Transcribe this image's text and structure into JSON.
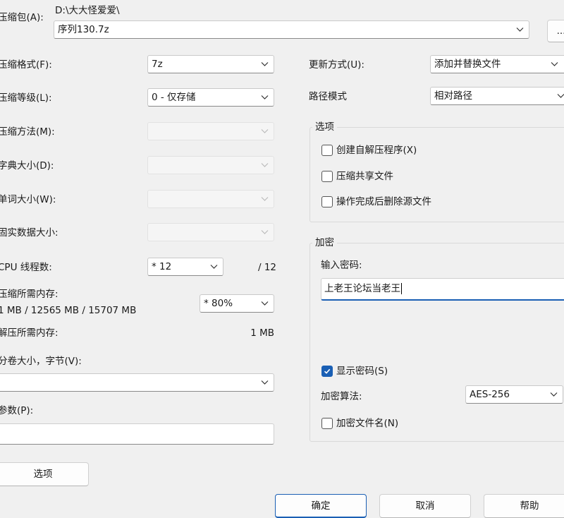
{
  "archive": {
    "label": "压缩包(A):",
    "path": "D:\\大大怪爱爱\\",
    "filename": "序列130.7z",
    "browse_label": "..."
  },
  "left": {
    "format_label": "压缩格式(F):",
    "format_value": "7z",
    "level_label": "压缩等级(L):",
    "level_value": "0 - 仅存储",
    "method_label": "压缩方法(M):",
    "dict_label": "字典大小(D):",
    "word_label": "单词大小(W):",
    "solid_label": "固实数据大小:",
    "cpu_label": "CPU 线程数:",
    "cpu_value": "* 12",
    "cpu_max": "/ 12",
    "mem_comp_label": "压缩所需内存:",
    "mem_comp_value": "1 MB / 12565 MB / 15707 MB",
    "mem_percent": "* 80%",
    "mem_decomp_label": "解压所需内存:",
    "mem_decomp_value": "1 MB",
    "volume_label": "分卷大小，字节(V):",
    "volume_value": "",
    "params_label": "参数(P):",
    "params_value": "",
    "options_button": "选项"
  },
  "right": {
    "update_label": "更新方式(U):",
    "update_value": "添加并替换文件",
    "path_label": "路径模式",
    "path_value": "相对路径",
    "options_group": {
      "title": "选项",
      "sfx": {
        "label": "创建自解压程序(X)",
        "checked": false
      },
      "shared": {
        "label": "压缩共享文件",
        "checked": false
      },
      "delete": {
        "label": "操作完成后删除源文件",
        "checked": false
      }
    },
    "encryption": {
      "title": "加密",
      "password_label": "输入密码:",
      "password_value": "上老王论坛当老王",
      "show_password": {
        "label": "显示密码(S)",
        "checked": true
      },
      "method_label": "加密算法:",
      "method_value": "AES-256",
      "encrypt_names": {
        "label": "加密文件名(N)",
        "checked": false
      }
    }
  },
  "footer": {
    "ok": "确定",
    "cancel": "取消",
    "help": "帮助"
  }
}
